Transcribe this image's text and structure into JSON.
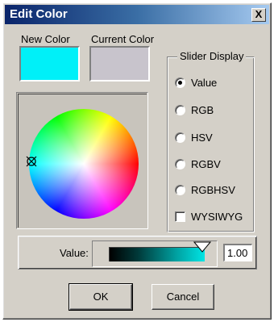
{
  "window": {
    "title": "Edit Color",
    "close_label": "X"
  },
  "swatches": {
    "new_label": "New Color",
    "current_label": "Current Color",
    "new_color": "#00f0f8",
    "current_color": "#c8c4cc"
  },
  "wheel": {
    "cursor_icon": "crosshair-icon"
  },
  "slider_display": {
    "title": "Slider Display",
    "options": [
      {
        "label": "Value",
        "checked": true
      },
      {
        "label": "RGB",
        "checked": false
      },
      {
        "label": "HSV",
        "checked": false
      },
      {
        "label": "RGBV",
        "checked": false
      },
      {
        "label": "RGBHSV",
        "checked": false
      }
    ],
    "wysiwyg": {
      "label": "WYSIWYG",
      "checked": false
    }
  },
  "value_control": {
    "label": "Value:",
    "value": "1.00",
    "level": 1.0
  },
  "buttons": {
    "ok": "OK",
    "cancel": "Cancel"
  }
}
